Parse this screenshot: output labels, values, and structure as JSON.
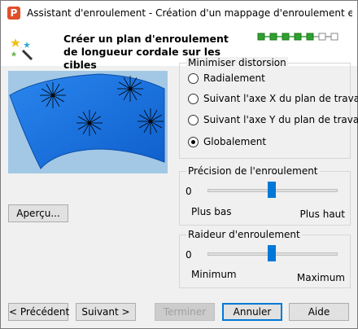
{
  "window": {
    "title": "Assistant d'enroulement - Création d'un mappage d'enroulement en l..."
  },
  "header": {
    "heading": "Créer un plan d'enroulement de longueur cordale sur les cibles",
    "steps_total": 7,
    "steps_completed": 5
  },
  "preview_button": "Aperçu...",
  "distortion": {
    "label": "Minimiser distorsion",
    "options": [
      "Radialement",
      "Suivant l'axe X du plan de travail",
      "Suivant l'axe Y du plan de travail",
      "Globalement"
    ],
    "selected": "Globalement"
  },
  "precision": {
    "label": "Précision de l'enroulement",
    "value_display": "0",
    "low_label": "Plus bas",
    "high_label": "Plus haut",
    "level": 0.5
  },
  "stiffness": {
    "label": "Raideur d'enroulement",
    "value_display": "0",
    "low_label": "Minimum",
    "high_label": "Maximum",
    "level": 0.5
  },
  "footer": {
    "previous": "< Précédent",
    "next": "Suivant >",
    "finish": "Terminer",
    "cancel": "Annuler",
    "help": "Aide"
  },
  "colors": {
    "accent": "#0078d7",
    "surface": "#1a73e8",
    "step_done": "#2ea02e"
  }
}
